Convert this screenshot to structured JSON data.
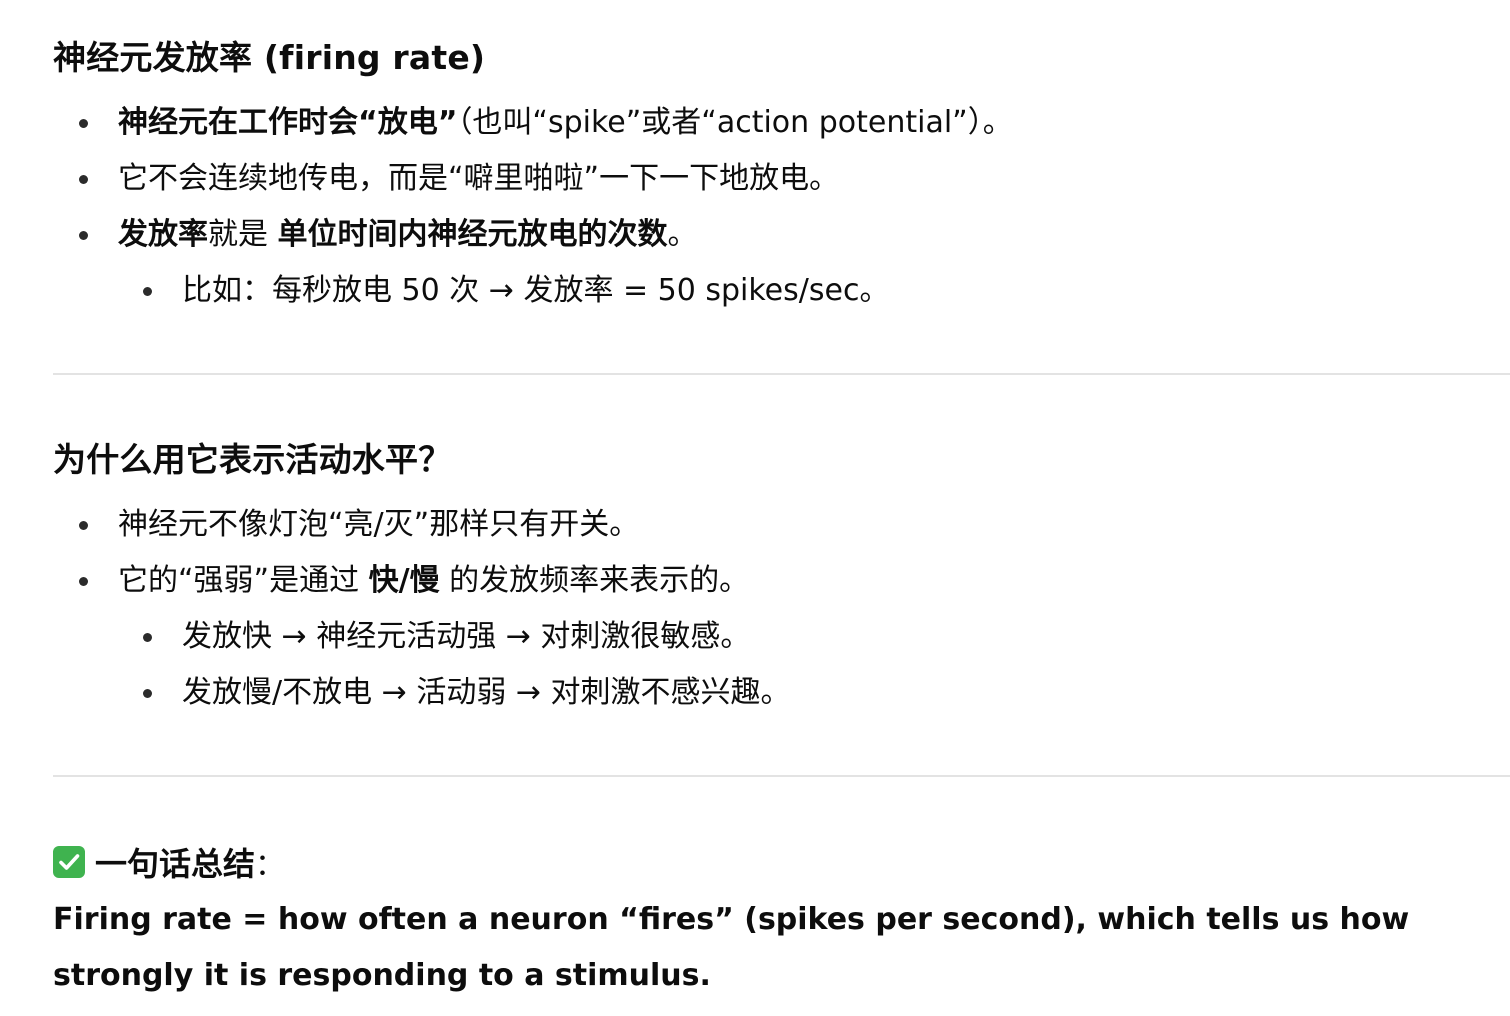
{
  "section1": {
    "title": "神经元发放率 (firing rate)",
    "bullets": [
      {
        "bold": "神经元在工作时会“放电”",
        "text": "（也叫“spike”或者“action potential”）。"
      },
      {
        "text": "它不会连续地传电，而是“噼里啪啦”一下一下地放电。"
      },
      {
        "bold": "发放率",
        "text": "就是 ",
        "bold2": "单位时间内神经元放电的次数",
        "text2": "。"
      }
    ],
    "sub_bullets": [
      {
        "text": "比如：每秒放电 50 次 → 发放率 = 50 spikes/sec。"
      }
    ]
  },
  "section2": {
    "title": "为什么用它表示活动水平？",
    "bullets": [
      {
        "text": "神经元不像灯泡“亮/灭”那样只有开关。"
      },
      {
        "text": "它的“强弱”是通过 ",
        "bold": "快/慢",
        "text2": " 的发放频率来表示的。"
      }
    ],
    "sub_bullets": [
      {
        "text": "发放快 → 神经元活动强 → 对刺激很敏感。"
      },
      {
        "text": "发放慢/不放电 → 活动弱 → 对刺激不感兴趣。"
      }
    ]
  },
  "summary": {
    "icon": "check-mark-icon",
    "icon_color": "#3fb34f",
    "title": "一句话总结",
    "colon": "：",
    "text": "Firing rate = how often a neuron “fires” (spikes per second), which tells us how strongly it is responding to a stimulus."
  }
}
